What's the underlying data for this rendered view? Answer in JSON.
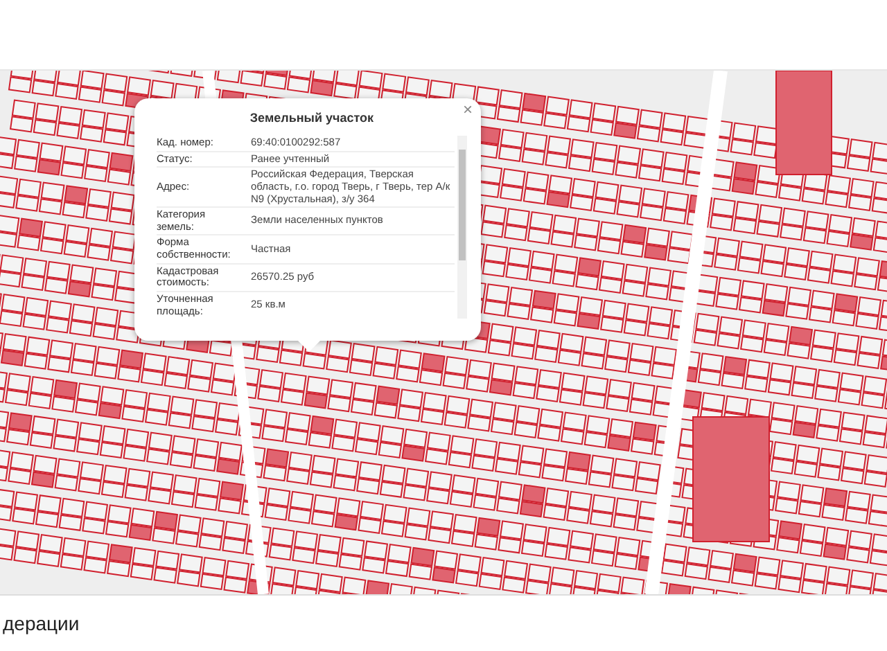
{
  "popup": {
    "title": "Земельный участок",
    "close": "×",
    "rows": [
      {
        "label": "Кад. номер:",
        "value": "69:40:0100292:587"
      },
      {
        "label": "Статус:",
        "value": "Ранее учтенный"
      },
      {
        "label": "Адрес:",
        "value": "Российская Федерация, Тверская область, г.о. город Тверь, г Тверь, тер А/к N9 (Хрустальная), з/у 364"
      },
      {
        "label": "Категория земель:",
        "value": "Земли населенных пунктов"
      },
      {
        "label": "Форма собственности:",
        "value": "Частная"
      },
      {
        "label": "Кадастровая стоимость:",
        "value": "26570.25 руб"
      },
      {
        "label": "Уточненная площадь:",
        "value": "25 кв.м"
      }
    ]
  },
  "heading": "дерации"
}
